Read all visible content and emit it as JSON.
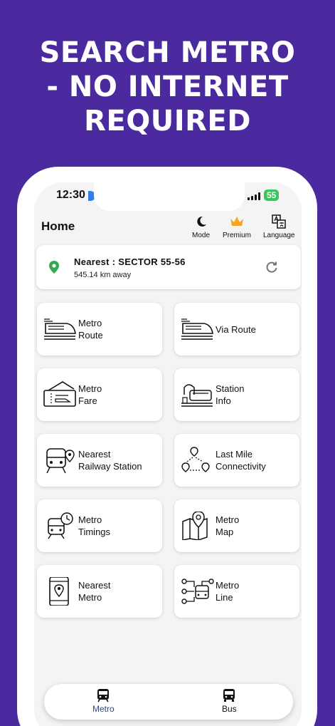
{
  "banner": {
    "line1": "SEARCH METRO",
    "line2": "- NO INTERNET",
    "line3": "REQUIRED"
  },
  "status_bar": {
    "time": "12:30",
    "battery": "55"
  },
  "app_bar": {
    "title": "Home",
    "actions": [
      {
        "label": "Mode",
        "icon": "moon-icon"
      },
      {
        "label": "Premium",
        "icon": "crown-icon",
        "color": "#f5a623"
      },
      {
        "label": "Language",
        "icon": "translate-icon"
      }
    ]
  },
  "nearest_card": {
    "station": "Nearest : SECTOR 55-56",
    "distance": "545.14 km away",
    "pin_color": "#34a853"
  },
  "tiles": [
    {
      "label": "Metro\nRoute",
      "icon": "train-icon"
    },
    {
      "label": "Via Route",
      "icon": "train-icon"
    },
    {
      "label": "Metro\nFare",
      "icon": "ticket-icon"
    },
    {
      "label": "Station\nInfo",
      "icon": "station-icon"
    },
    {
      "label": "Nearest\nRailway Station",
      "icon": "railway-location-icon"
    },
    {
      "label": "Last Mile\nConnectivity",
      "icon": "route-pins-icon"
    },
    {
      "label": "Metro\nTimings",
      "icon": "train-clock-icon"
    },
    {
      "label": "Metro\nMap",
      "icon": "map-icon"
    },
    {
      "label": "Nearest\nMetro",
      "icon": "phone-location-icon"
    },
    {
      "label": "Metro\nLine",
      "icon": "metro-line-icon"
    }
  ],
  "bottom_nav": [
    {
      "label": "Metro",
      "icon": "train-front-icon",
      "active": true,
      "color": "#2b4a8c"
    },
    {
      "label": "Bus",
      "icon": "bus-icon",
      "active": false,
      "color": "#111111"
    }
  ]
}
